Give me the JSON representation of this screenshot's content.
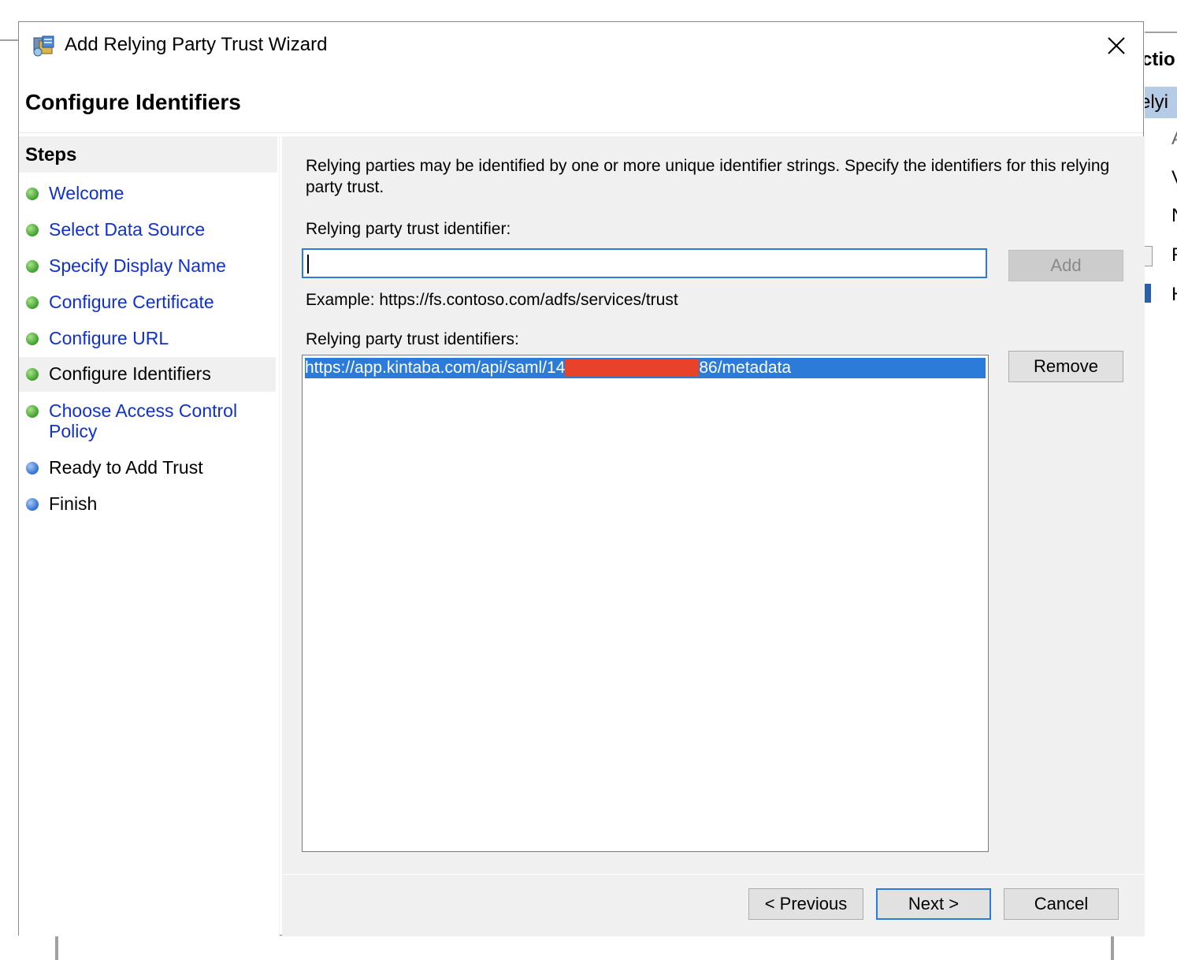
{
  "window": {
    "title": "Add Relying Party Trust Wizard",
    "app_icon": "adfs-wizard-icon",
    "close_icon": "close-icon"
  },
  "page": {
    "heading": "Configure Identifiers"
  },
  "steps": {
    "title": "Steps",
    "items": [
      {
        "label": "Welcome",
        "status": "done",
        "link": true
      },
      {
        "label": "Select Data Source",
        "status": "done",
        "link": true
      },
      {
        "label": "Specify Display Name",
        "status": "done",
        "link": true
      },
      {
        "label": "Configure Certificate",
        "status": "done",
        "link": true
      },
      {
        "label": "Configure URL",
        "status": "done",
        "link": true
      },
      {
        "label": "Configure Identifiers",
        "status": "current",
        "link": false
      },
      {
        "label": "Choose Access Control",
        "label2": "Policy",
        "status": "done",
        "link": true
      },
      {
        "label": "Ready to Add Trust",
        "status": "pending",
        "link": false
      },
      {
        "label": "Finish",
        "status": "pending",
        "link": false
      }
    ]
  },
  "main": {
    "description": "Relying parties may be identified by one or more unique identifier strings. Specify the identifiers for this relying party trust.",
    "identifier_label": "Relying party trust identifier:",
    "identifier_value": "",
    "add_label": "Add",
    "example": "Example: https://fs.contoso.com/adfs/services/trust",
    "identifiers_label": "Relying party trust identifiers:",
    "identifiers": [
      {
        "prefix": "https://app.kintaba.com/api/saml/14",
        "suffix": "86/metadata",
        "redacted": true
      }
    ],
    "remove_label": "Remove"
  },
  "footer": {
    "previous_label": "< Previous",
    "next_label": "Next >",
    "cancel_label": "Cancel"
  },
  "background": {
    "header_fragment": "ctio",
    "selected_fragment": "elyi",
    "row_fragments": [
      "A",
      "V",
      "N",
      "R",
      "H"
    ]
  },
  "colors": {
    "link": "#1030d0",
    "selection": "#2d7bd8",
    "done_dot": "#3c9f2b",
    "pending_dot": "#2d6fd0",
    "redaction": "#e8432a"
  }
}
